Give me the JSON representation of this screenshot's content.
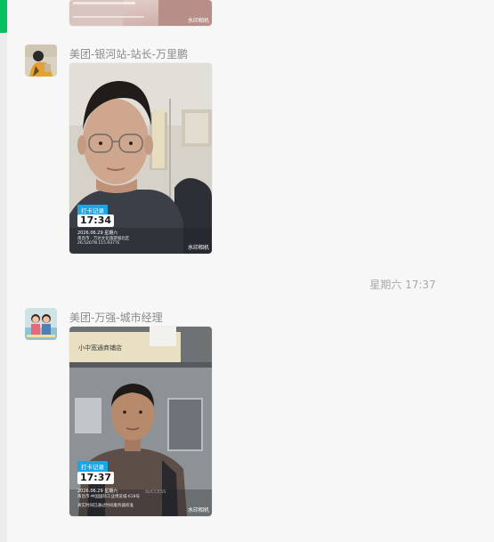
{
  "messages": [
    {
      "photo": {
        "watermark": "水印相机"
      }
    },
    {
      "sender": "美团-银河站-站长-万里鹏",
      "photo": {
        "checkin_label": "打卡记录",
        "checkin_time": "17:34",
        "date_line": "2026.06.29  星期六",
        "address_line": "南昌市 · 万达文化旅游城北区",
        "code_line": "26.5207N 115.9377E",
        "watermark": "水印相机"
      }
    },
    {
      "time_separator": "星期六 17:37"
    },
    {
      "sender": "美团-万强-城市经理",
      "photo": {
        "sign_text": "小中宽通商铺店",
        "checkin_label": "打卡记录",
        "checkin_time": "17:37",
        "date_line": "2026.06.29  星期六",
        "address_line": "南昌市·中国国际工业博览城·618号",
        "note_line": "真实时间已通过时间服务器校准",
        "watermark": "水印相机"
      }
    }
  ],
  "colors": {
    "accent": "#07c160",
    "checkin_tag": "#1aa5e6",
    "sender_text": "#8a8a8a"
  }
}
